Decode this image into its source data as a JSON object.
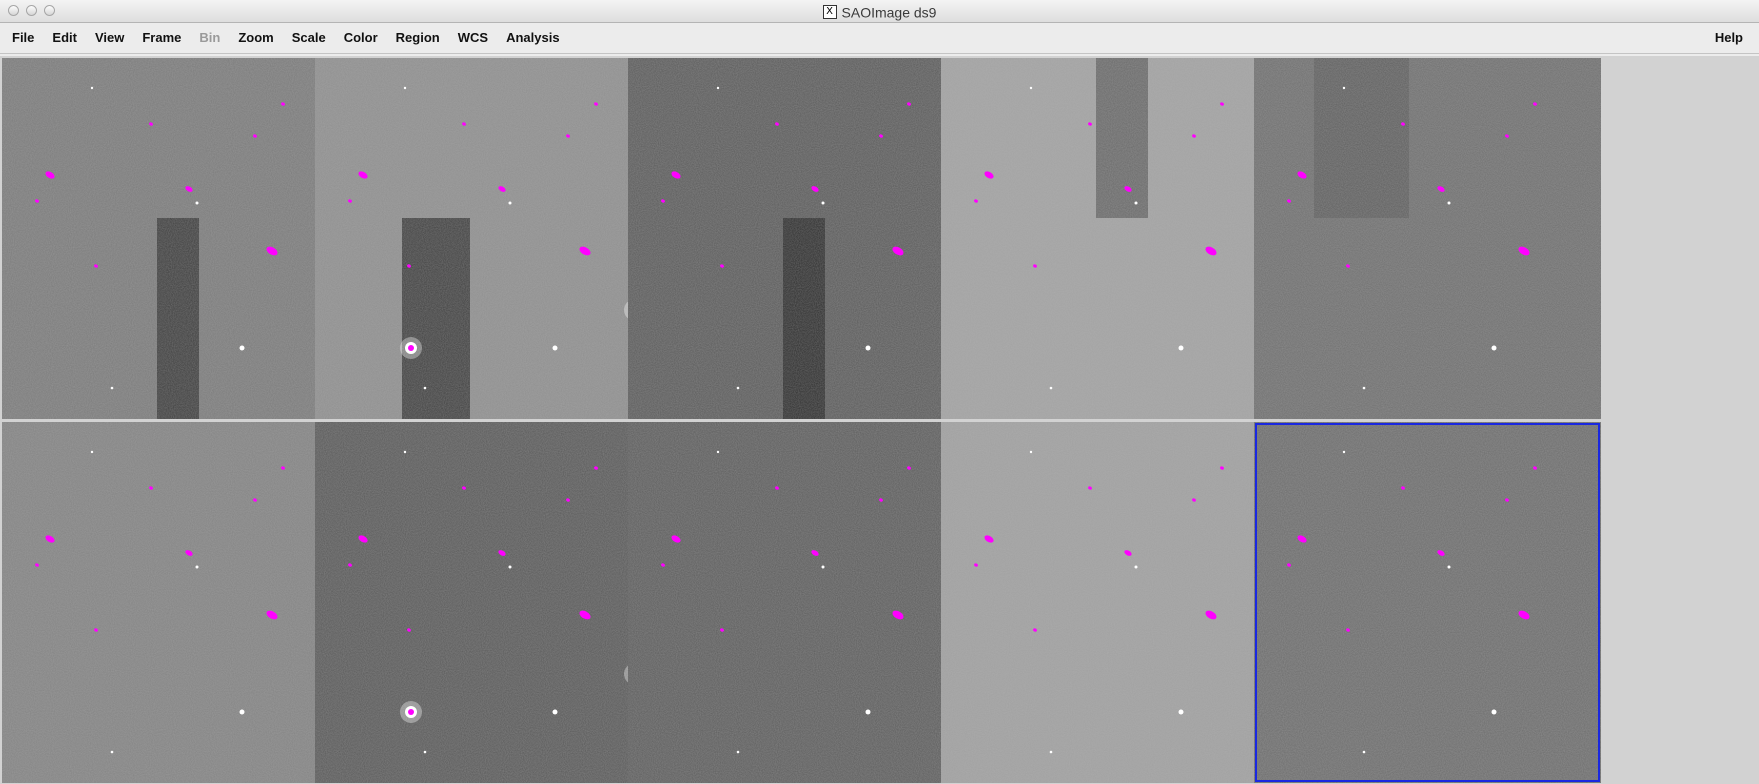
{
  "window": {
    "title": "SAOImage ds9",
    "x_icon": "X"
  },
  "menubar": {
    "items": [
      {
        "label": "File",
        "enabled": true
      },
      {
        "label": "Edit",
        "enabled": true
      },
      {
        "label": "View",
        "enabled": true
      },
      {
        "label": "Frame",
        "enabled": true
      },
      {
        "label": "Bin",
        "enabled": false
      },
      {
        "label": "Zoom",
        "enabled": true
      },
      {
        "label": "Scale",
        "enabled": true
      },
      {
        "label": "Color",
        "enabled": true
      },
      {
        "label": "Region",
        "enabled": true
      },
      {
        "label": "WCS",
        "enabled": true
      },
      {
        "label": "Analysis",
        "enabled": true
      }
    ],
    "help_label": "Help"
  },
  "tile_grid": {
    "rows": 2,
    "columns": 5,
    "active_frame": 10,
    "active_border_color": "#1a28e0",
    "region_color": "#ff00ff",
    "frames": [
      {
        "index": 1,
        "gray": "#7a7a7a",
        "dark_patch": "bottom"
      },
      {
        "index": 2,
        "gray": "#8e8e8e",
        "dark_patch": "bottom-large",
        "bright_stars": true
      },
      {
        "index": 3,
        "gray": "#5a5a5a",
        "dark_patch": "bottom"
      },
      {
        "index": 4,
        "gray": "#a2a2a2",
        "dark_patch": "top"
      },
      {
        "index": 5,
        "gray": "#6e6e6e",
        "dark_patch": "top-faint"
      },
      {
        "index": 6,
        "gray": "#828282",
        "dark_patch": "none"
      },
      {
        "index": 7,
        "gray": "#585858",
        "dark_patch": "none",
        "bright_stars": true
      },
      {
        "index": 8,
        "gray": "#5c5c5c",
        "dark_patch": "none"
      },
      {
        "index": 9,
        "gray": "#a0a0a0",
        "dark_patch": "none"
      },
      {
        "index": 10,
        "gray": "#6c6c6c",
        "dark_patch": "none"
      }
    ]
  }
}
